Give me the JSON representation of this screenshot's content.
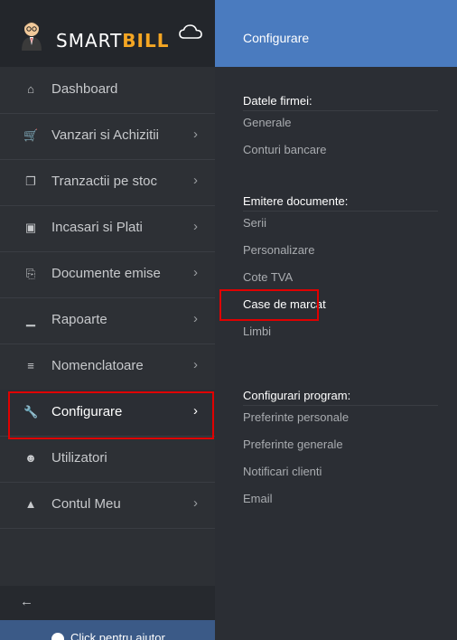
{
  "brand": {
    "name_part1": "SMART",
    "name_part2": "BILL"
  },
  "sidebar": {
    "items": [
      {
        "label": "Dashboard",
        "icon": "home-icon",
        "has_arrow": false
      },
      {
        "label": "Vanzari si Achizitii",
        "icon": "cart-icon",
        "has_arrow": true
      },
      {
        "label": "Tranzactii pe stoc",
        "icon": "copy-icon",
        "has_arrow": true
      },
      {
        "label": "Incasari si Plati",
        "icon": "money-icon",
        "has_arrow": true
      },
      {
        "label": "Documente emise",
        "icon": "documents-icon",
        "has_arrow": true
      },
      {
        "label": "Rapoarte",
        "icon": "bar-chart-icon",
        "has_arrow": true
      },
      {
        "label": "Nomenclatoare",
        "icon": "list-icon",
        "has_arrow": true
      },
      {
        "label": "Configurare",
        "icon": "wrench-icon",
        "has_arrow": true
      },
      {
        "label": "Utilizatori",
        "icon": "users-icon",
        "has_arrow": false
      },
      {
        "label": "Contul Meu",
        "icon": "user-icon",
        "has_arrow": true
      }
    ],
    "active_item": "Configurare",
    "bottom_text": "Click pentru ajutor"
  },
  "panel": {
    "header_title": "Configurare",
    "sections": [
      {
        "title": "Datele firmei:",
        "links": [
          "Generale",
          "Conturi bancare"
        ]
      },
      {
        "title": "Emitere documente:",
        "links": [
          "Serii",
          "Personalizare",
          "Cote TVA",
          "Case de marcat",
          "Limbi"
        ]
      },
      {
        "title": "Configurari program:",
        "links": [
          "Preferinte personale",
          "Preferinte generale",
          "Notificari clienti",
          "Email"
        ]
      }
    ],
    "active_link": "Case de marcat"
  },
  "colors": {
    "sidebar_bg": "#2d3035",
    "header_blue": "#4a7bbf",
    "highlight_red": "#e00000",
    "brand_orange": "#f5a623"
  }
}
